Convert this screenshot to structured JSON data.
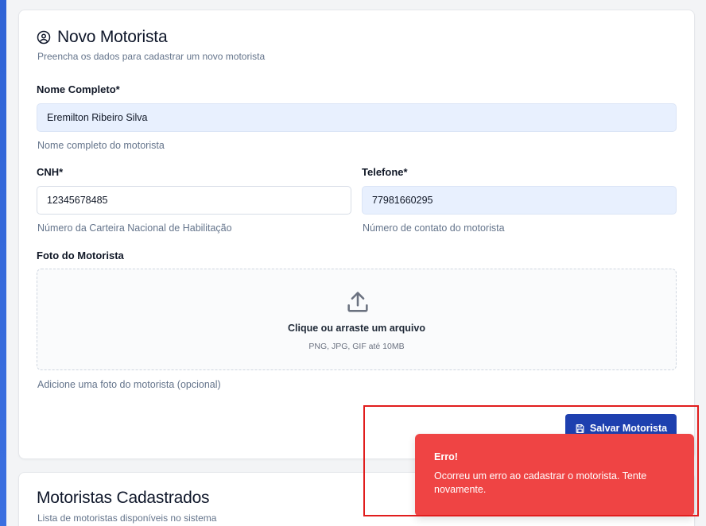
{
  "form": {
    "title": "Novo Motorista",
    "subtitle": "Preencha os dados para cadastrar um novo motorista",
    "icon": "user-circle-icon",
    "nome": {
      "label": "Nome Completo*",
      "value": "Eremilton Ribeiro Silva",
      "helper": "Nome completo do motorista"
    },
    "cnh": {
      "label": "CNH*",
      "value": "12345678485",
      "helper": "Número da Carteira Nacional de Habilitação"
    },
    "telefone": {
      "label": "Telefone*",
      "value": "77981660295",
      "helper": "Número de contato do motorista"
    },
    "foto": {
      "label": "Foto do Motorista",
      "dropzone_title": "Clique ou arraste um arquivo",
      "dropzone_sub": "PNG, JPG, GIF até 10MB",
      "helper": "Adicione uma foto do motorista (opcional)",
      "icon": "upload-icon"
    },
    "save_label": "Salvar Motorista",
    "save_icon": "save-icon"
  },
  "list": {
    "title": "Motoristas Cadastrados",
    "subtitle": "Lista de motoristas disponíveis no sistema"
  },
  "toast": {
    "title": "Erro!",
    "message": "Ocorreu um erro ao cadastrar o motorista. Tente novamente."
  },
  "colors": {
    "accent": "#1e40af",
    "error": "#ef4444",
    "filled_input": "#e8f0fe",
    "highlight": "#e11d1d"
  }
}
